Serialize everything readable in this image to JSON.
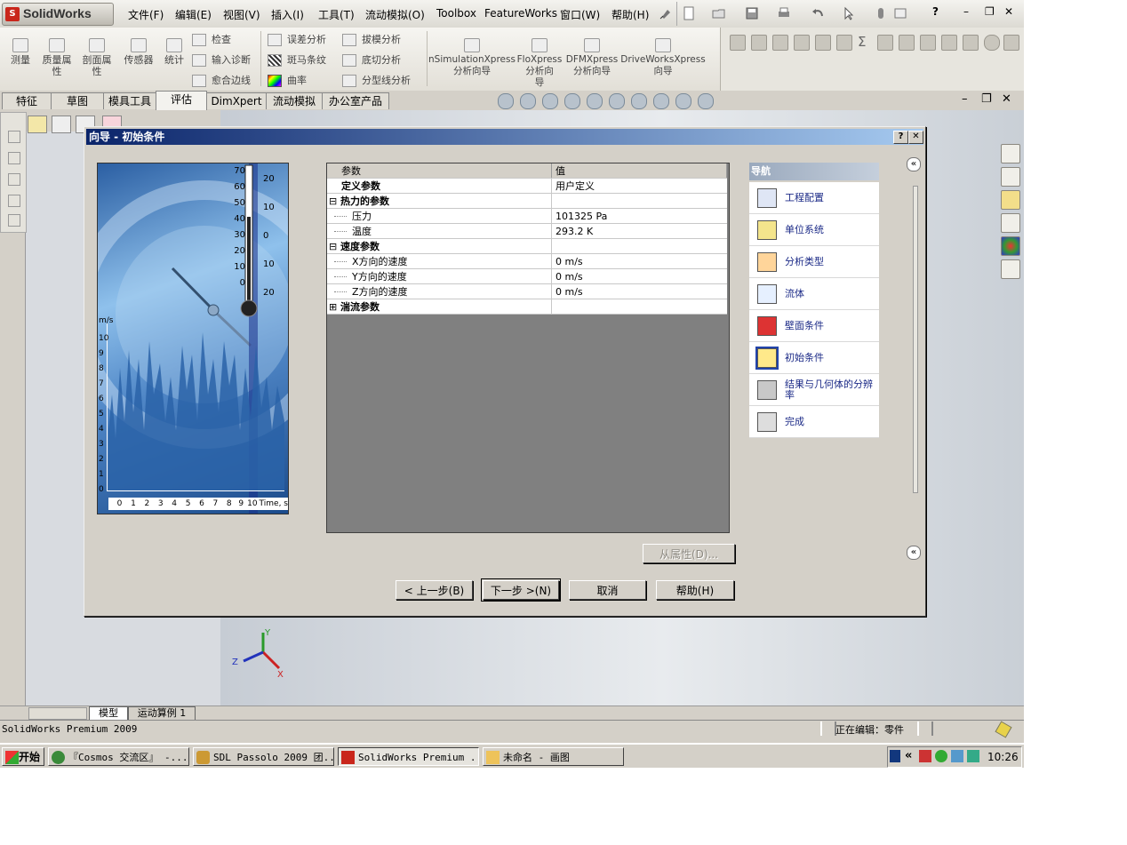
{
  "app": {
    "logo_text": "SolidWorks"
  },
  "menu": [
    "文件(F)",
    "编辑(E)",
    "视图(V)",
    "插入(I)",
    "工具(T)",
    "流动模拟(O)",
    "Toolbox",
    "FeatureWorks",
    "窗口(W)",
    "帮助(H)"
  ],
  "commandmanager": {
    "big": [
      "测量",
      "质量属\n性",
      "剖面属\n性",
      "传感器",
      "统计"
    ],
    "col1": [
      "检查",
      "输入诊断",
      "愈合边线"
    ],
    "col2": [
      "误差分析",
      "斑马条纹",
      "曲率"
    ],
    "col3": [
      "拔模分析",
      "底切分析",
      "分型线分析"
    ],
    "xpress": [
      "nSimulationXpress\n分析向导",
      "FloXpress\n分析向\n导",
      "DFMXpress\n分析向导",
      "DriveWorksXpress\n向导"
    ]
  },
  "tabs": [
    "特征",
    "草图",
    "模具工具",
    "评估",
    "DimXpert",
    "流动模拟",
    "办公室产品"
  ],
  "active_tab": "评估",
  "dialog": {
    "title": "向导 - 初始条件",
    "help_btn": "?",
    "close_btn": "✕",
    "grid_header": [
      "参数",
      "值"
    ],
    "rows": [
      {
        "indent": 0,
        "expander": "",
        "label": "定义参数",
        "value": "用户定义",
        "bold": true
      },
      {
        "indent": 0,
        "expander": "⊟",
        "label": "热力的参数",
        "value": "",
        "bold": true
      },
      {
        "indent": 1,
        "expander": "",
        "label": "压力",
        "value": "101325 Pa",
        "bold": false
      },
      {
        "indent": 1,
        "expander": "",
        "label": "温度",
        "value": "293.2 K",
        "bold": false
      },
      {
        "indent": 0,
        "expander": "⊟",
        "label": "速度参数",
        "value": "",
        "bold": true
      },
      {
        "indent": 1,
        "expander": "",
        "label": "X方向的速度",
        "value": "0 m/s",
        "bold": false
      },
      {
        "indent": 1,
        "expander": "",
        "label": "Y方向的速度",
        "value": "0 m/s",
        "bold": false
      },
      {
        "indent": 1,
        "expander": "",
        "label": "Z方向的速度",
        "value": "0 m/s",
        "bold": false
      },
      {
        "indent": 0,
        "expander": "⊞",
        "label": "湍流参数",
        "value": "",
        "bold": true
      }
    ],
    "nav_title": "导航",
    "nav_items": [
      "工程配置",
      "单位系统",
      "分析类型",
      "流体",
      "壁面条件",
      "初始条件",
      "结果与几何体的分辨率",
      "完成"
    ],
    "nav_current": 5,
    "from_props_btn": "从属性(D)...",
    "back_btn": "< 上一步(B)",
    "next_btn": "下一步 >(N)",
    "cancel_btn": "取消",
    "help_button": "帮助(H)",
    "collapse_glyph": "«",
    "picture": {
      "thermo_left": [
        "70",
        "60",
        "50",
        "40",
        "30",
        "20",
        "10",
        "0"
      ],
      "thermo_right": [
        "20",
        "10",
        "0",
        "10",
        "20"
      ],
      "y_unit": "m/s",
      "y_ticks": [
        "10",
        "9",
        "8",
        "7",
        "6",
        "5",
        "4",
        "3",
        "2",
        "1",
        "0"
      ],
      "x_ticks": [
        "0",
        "1",
        "2",
        "3",
        "4",
        "5",
        "6",
        "7",
        "8",
        "9",
        "10"
      ],
      "x_unit": "Time, s"
    }
  },
  "bottom_tabs": [
    "模型",
    "运动算例 1"
  ],
  "status": {
    "left": "SolidWorks Premium 2009",
    "right": "正在编辑：零件"
  },
  "taskbar": {
    "start": "开始",
    "buttons": [
      "『Cosmos 交流区』 -...",
      "SDL Passolo 2009 团...",
      "SolidWorks Premium ...",
      "未命名 - 画图"
    ],
    "tray_chevron": "«",
    "clock": "10:26"
  },
  "axes": {
    "x": "X",
    "y": "Y",
    "z": "Z"
  }
}
